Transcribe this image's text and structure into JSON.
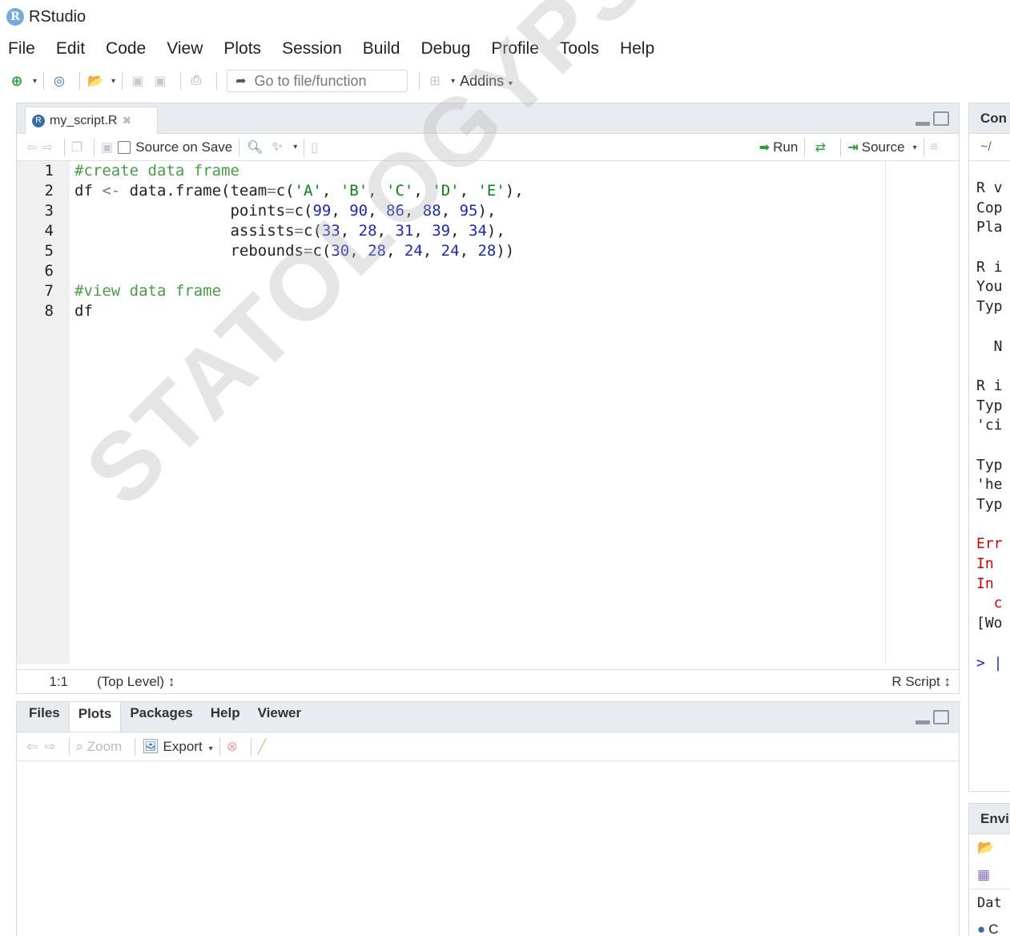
{
  "app": {
    "logo_letter": "R",
    "title": "RStudio"
  },
  "menu": [
    "File",
    "Edit",
    "Code",
    "View",
    "Plots",
    "Session",
    "Build",
    "Debug",
    "Profile",
    "Tools",
    "Help"
  ],
  "main_toolbar": {
    "goto_placeholder": "Go to file/function",
    "addins_label": "Addins"
  },
  "source_pane": {
    "tab_label": "my_script.R",
    "source_on_save_label": "Source on Save",
    "run_label": "Run",
    "source_label": "Source",
    "line_numbers": [
      "1",
      "2",
      "3",
      "4",
      "5",
      "6",
      "7",
      "8"
    ],
    "status": {
      "position": "1:1",
      "level": "(Top Level) ↕",
      "file_type": "R Script ↕"
    }
  },
  "code_lines": [
    [
      {
        "t": "#create data frame",
        "c": "cmt"
      }
    ],
    [
      {
        "t": "df ",
        "c": ""
      },
      {
        "t": "<-",
        "c": "op"
      },
      {
        "t": " data.frame(team",
        "c": ""
      },
      {
        "t": "=",
        "c": "op"
      },
      {
        "t": "c(",
        "c": ""
      },
      {
        "t": "'A'",
        "c": "str"
      },
      {
        "t": ", ",
        "c": ""
      },
      {
        "t": "'B'",
        "c": "str"
      },
      {
        "t": ", ",
        "c": ""
      },
      {
        "t": "'C'",
        "c": "str"
      },
      {
        "t": ", ",
        "c": ""
      },
      {
        "t": "'D'",
        "c": "str"
      },
      {
        "t": ", ",
        "c": ""
      },
      {
        "t": "'E'",
        "c": "str"
      },
      {
        "t": "),",
        "c": ""
      }
    ],
    [
      {
        "t": "                 points",
        "c": ""
      },
      {
        "t": "=",
        "c": "op"
      },
      {
        "t": "c(",
        "c": ""
      },
      {
        "t": "99",
        "c": "num"
      },
      {
        "t": ", ",
        "c": ""
      },
      {
        "t": "90",
        "c": "num"
      },
      {
        "t": ", ",
        "c": ""
      },
      {
        "t": "86",
        "c": "num"
      },
      {
        "t": ", ",
        "c": ""
      },
      {
        "t": "88",
        "c": "num"
      },
      {
        "t": ", ",
        "c": ""
      },
      {
        "t": "95",
        "c": "num"
      },
      {
        "t": "),",
        "c": ""
      }
    ],
    [
      {
        "t": "                 assists",
        "c": ""
      },
      {
        "t": "=",
        "c": "op"
      },
      {
        "t": "c(",
        "c": ""
      },
      {
        "t": "33",
        "c": "num"
      },
      {
        "t": ", ",
        "c": ""
      },
      {
        "t": "28",
        "c": "num"
      },
      {
        "t": ", ",
        "c": ""
      },
      {
        "t": "31",
        "c": "num"
      },
      {
        "t": ", ",
        "c": ""
      },
      {
        "t": "39",
        "c": "num"
      },
      {
        "t": ", ",
        "c": ""
      },
      {
        "t": "34",
        "c": "num"
      },
      {
        "t": "),",
        "c": ""
      }
    ],
    [
      {
        "t": "                 rebounds",
        "c": ""
      },
      {
        "t": "=",
        "c": "op"
      },
      {
        "t": "c(",
        "c": ""
      },
      {
        "t": "30",
        "c": "num"
      },
      {
        "t": ", ",
        "c": ""
      },
      {
        "t": "28",
        "c": "num"
      },
      {
        "t": ", ",
        "c": ""
      },
      {
        "t": "24",
        "c": "num"
      },
      {
        "t": ", ",
        "c": ""
      },
      {
        "t": "24",
        "c": "num"
      },
      {
        "t": ", ",
        "c": ""
      },
      {
        "t": "28",
        "c": "num"
      },
      {
        "t": "))",
        "c": ""
      }
    ],
    [
      {
        "t": "",
        "c": ""
      }
    ],
    [
      {
        "t": "#view data frame",
        "c": "cmt"
      }
    ],
    [
      {
        "t": "df",
        "c": ""
      }
    ]
  ],
  "files_pane": {
    "tabs": [
      "Files",
      "Plots",
      "Packages",
      "Help",
      "Viewer"
    ],
    "active_tab": "Plots",
    "zoom_label": "Zoom",
    "export_label": "Export"
  },
  "console_pane": {
    "header": "Con",
    "path": "~/",
    "lines": [
      {
        "t": "R v",
        "c": ""
      },
      {
        "t": "Cop",
        "c": ""
      },
      {
        "t": "Pla",
        "c": ""
      },
      {
        "t": "",
        "c": ""
      },
      {
        "t": "R i",
        "c": ""
      },
      {
        "t": "You",
        "c": ""
      },
      {
        "t": "Typ",
        "c": ""
      },
      {
        "t": "",
        "c": ""
      },
      {
        "t": "  N",
        "c": ""
      },
      {
        "t": "",
        "c": ""
      },
      {
        "t": "R i",
        "c": ""
      },
      {
        "t": "Typ",
        "c": ""
      },
      {
        "t": "'ci",
        "c": ""
      },
      {
        "t": "",
        "c": ""
      },
      {
        "t": "Typ",
        "c": ""
      },
      {
        "t": "'he",
        "c": ""
      },
      {
        "t": "Typ",
        "c": ""
      },
      {
        "t": "",
        "c": ""
      },
      {
        "t": "Err",
        "c": "red"
      },
      {
        "t": "In",
        "c": "red"
      },
      {
        "t": "In",
        "c": "red"
      },
      {
        "t": "  c",
        "c": "red"
      },
      {
        "t": "[Wo",
        "c": ""
      },
      {
        "t": "",
        "c": ""
      },
      {
        "t": "> |",
        "c": "blue-prompt"
      }
    ]
  },
  "env_pane": {
    "header": "Envi",
    "row_data_label": "Dat",
    "row_c_label": "C"
  },
  "watermark": "STATOLOGYPSYCHOLOGY.COM"
}
